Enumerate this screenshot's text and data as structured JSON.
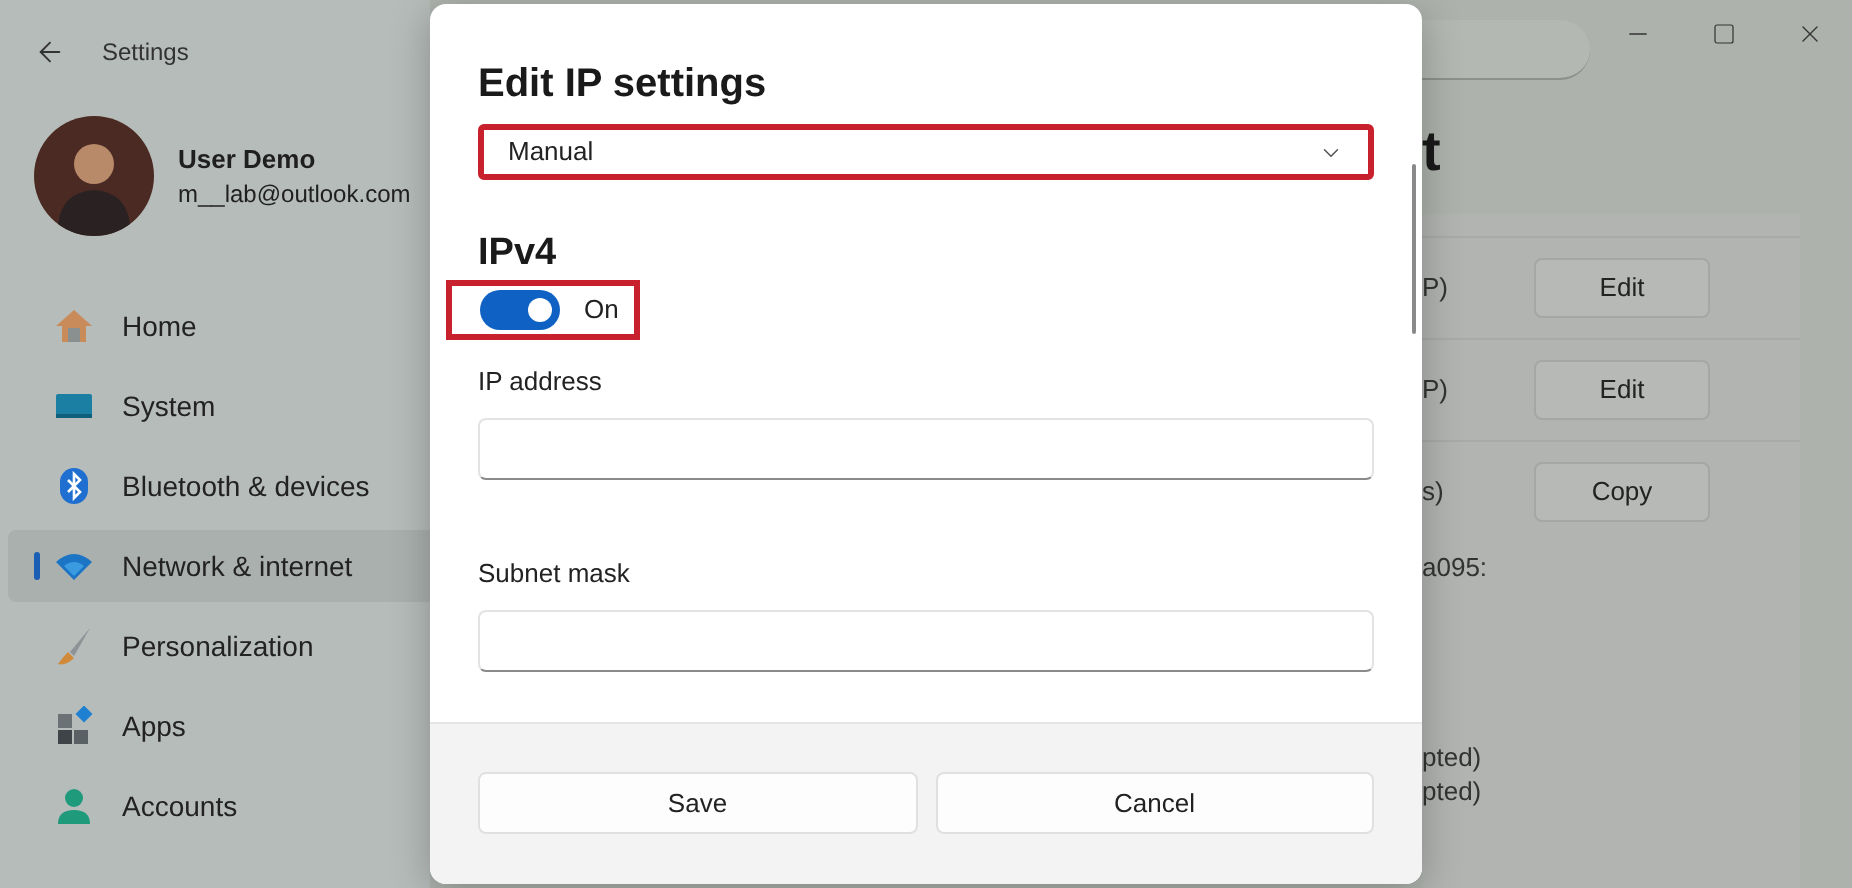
{
  "window": {
    "title": "Settings"
  },
  "user": {
    "name": "User Demo",
    "email": "m__lab@outlook.com"
  },
  "nav": [
    {
      "label": "Home",
      "kind": "home",
      "selected": false
    },
    {
      "label": "System",
      "kind": "system",
      "selected": false
    },
    {
      "label": "Bluetooth & devices",
      "kind": "bluetooth",
      "selected": false
    },
    {
      "label": "Network & internet",
      "kind": "network",
      "selected": true
    },
    {
      "label": "Personalization",
      "kind": "personalization",
      "selected": false
    },
    {
      "label": "Apps",
      "kind": "apps",
      "selected": false
    },
    {
      "label": "Accounts",
      "kind": "accounts",
      "selected": false
    }
  ],
  "background_page": {
    "heading": "t",
    "rows": [
      {
        "text": "P)",
        "button": "Edit"
      },
      {
        "text": "P)",
        "button": "Edit"
      },
      {
        "text": "s)",
        "button": "Copy"
      }
    ],
    "lines": [
      "a095:",
      "pted)",
      "pted)"
    ]
  },
  "dialog": {
    "title": "Edit IP settings",
    "mode": {
      "value": "Manual",
      "highlighted": true
    },
    "section": "IPv4",
    "toggle": {
      "on": true,
      "label": "On",
      "highlighted": true
    },
    "fields": [
      {
        "label": "IP address"
      },
      {
        "label": "Subnet mask"
      }
    ],
    "buttons": [
      "Save",
      "Cancel"
    ]
  }
}
